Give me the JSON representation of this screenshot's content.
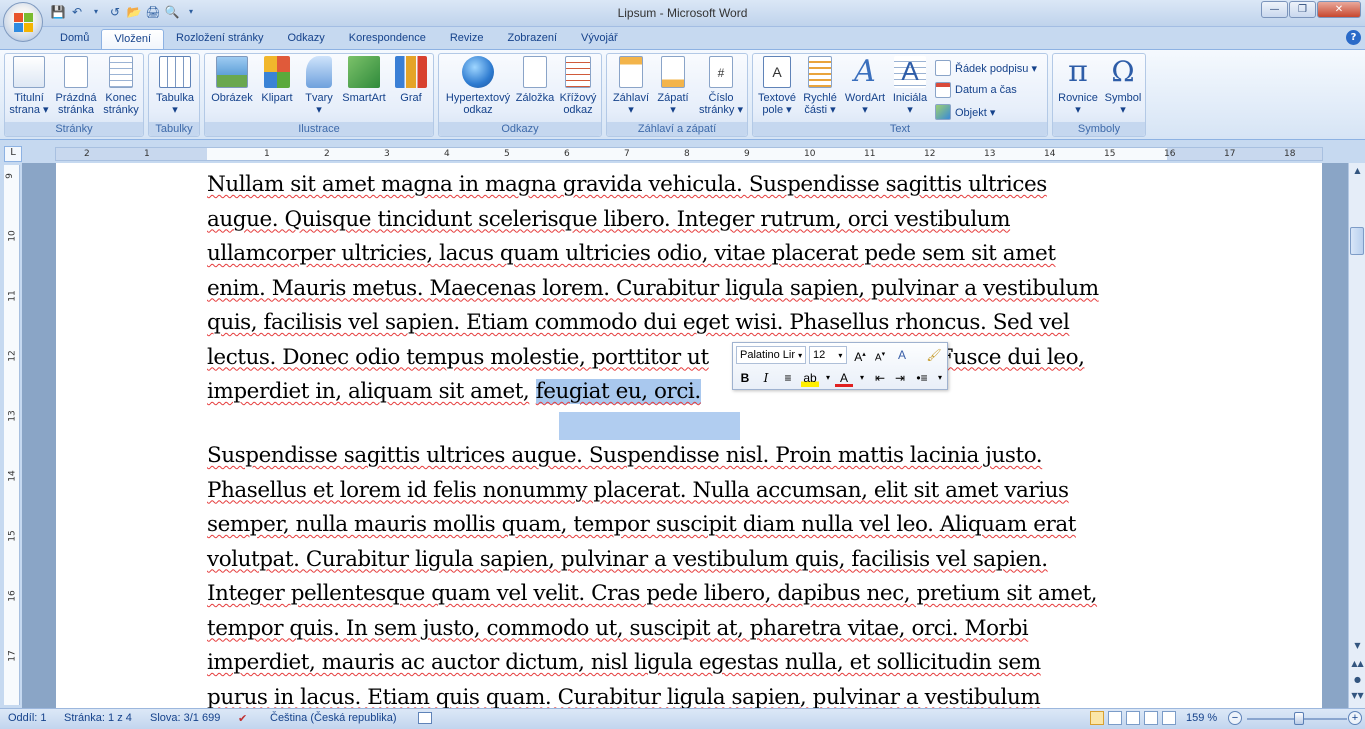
{
  "window": {
    "title": "Lipsum - Microsoft Word"
  },
  "quick_access": [
    "save-icon",
    "undo-icon",
    "redo-icon",
    "open-icon",
    "print-icon",
    "print-preview-icon"
  ],
  "tabs": [
    "Domů",
    "Vložení",
    "Rozložení stránky",
    "Odkazy",
    "Korespondence",
    "Revize",
    "Zobrazení",
    "Vývojář"
  ],
  "active_tab": "Vložení",
  "ribbon": {
    "groups": {
      "pages": {
        "title": "Stránky",
        "buttons": [
          [
            "Titulní",
            "strana ▾"
          ],
          [
            "Prázdná",
            "stránka"
          ],
          [
            "Konec",
            "stránky"
          ]
        ]
      },
      "tables": {
        "title": "Tabulky",
        "buttons": [
          [
            "Tabulka",
            "▾"
          ]
        ]
      },
      "illustrations": {
        "title": "Ilustrace",
        "buttons": [
          [
            "Obrázek",
            ""
          ],
          [
            "Klipart",
            ""
          ],
          [
            "Tvary",
            "▾"
          ],
          [
            "SmartArt",
            ""
          ],
          [
            "Graf",
            ""
          ]
        ]
      },
      "links": {
        "title": "Odkazy",
        "buttons": [
          [
            "Hypertextový",
            "odkaz"
          ],
          [
            "Záložka",
            ""
          ],
          [
            "Křížový",
            "odkaz"
          ]
        ]
      },
      "header_footer": {
        "title": "Záhlaví a zápatí",
        "buttons": [
          [
            "Záhlaví",
            "▾"
          ],
          [
            "Zápatí",
            "▾"
          ],
          [
            "Číslo",
            "stránky ▾"
          ]
        ]
      },
      "text": {
        "title": "Text",
        "buttons": [
          [
            "Textové",
            "pole ▾"
          ],
          [
            "Rychlé",
            "části ▾"
          ],
          [
            "WordArt",
            "▾"
          ],
          [
            "Iniciála",
            "▾"
          ]
        ],
        "small": [
          "Řádek podpisu ▾",
          "Datum a čas",
          "Objekt ▾"
        ]
      },
      "symbols": {
        "title": "Symboly",
        "buttons": [
          [
            "Rovnice",
            "▾"
          ],
          [
            "Symbol",
            "▾"
          ]
        ]
      }
    }
  },
  "ruler": {
    "h_numbers": [
      "2",
      "1",
      "1",
      "2",
      "3",
      "4",
      "5",
      "6",
      "7",
      "8",
      "9",
      "10",
      "11",
      "12",
      "13",
      "14",
      "15",
      "16",
      "17",
      "18"
    ],
    "v_numbers": [
      "9",
      "10",
      "11",
      "12",
      "13",
      "14",
      "15",
      "16",
      "17"
    ]
  },
  "document": {
    "para1": [
      "Nullam sit amet magna in magna gravida vehicula. Suspendisse sagittis ultrices",
      "augue. Quisque tincidunt scelerisque libero. Integer rutrum, orci vestibulum",
      "ullamcorper ultricies, lacus quam ultricies odio, vitae placerat pede sem sit amet",
      "enim. Mauris metus. Maecenas lorem. Curabitur ligula sapien, pulvinar a vestibulum",
      "quis, facilisis vel sapien. Etiam commodo dui eget wisi. Phasellus rhoncus. Sed vel",
      "lectus. Donec odio tempus molestie, porttitor ut",
      "Fusce dui leo,",
      "imperdiet in, aliquam sit amet,",
      "feugiat eu, orci."
    ],
    "para2": [
      "Suspendisse sagittis ultrices augue. Suspendisse nisl. Proin mattis lacinia justo.",
      "Phasellus et lorem id felis nonummy placerat. Nulla accumsan, elit sit amet varius",
      "semper, nulla mauris mollis quam, tempor suscipit diam nulla vel leo. Aliquam erat",
      "volutpat. Curabitur ligula sapien, pulvinar a vestibulum quis, facilisis vel sapien.",
      "Integer pellentesque quam vel velit. Cras pede libero, dapibus nec, pretium sit amet,",
      "tempor quis. In sem justo, commodo ut, suscipit at, pharetra vitae, orci. Morbi",
      "imperdiet, mauris ac auctor dictum, nisl ligula egestas nulla, et sollicitudin sem",
      "purus in lacus. Etiam quis quam. Curabitur ligula sapien, pulvinar a vestibulum"
    ]
  },
  "mini_toolbar": {
    "font": "Palatino Lir",
    "size": "12"
  },
  "status": {
    "section": "Oddíl: 1",
    "page": "Stránka: 1 z 4",
    "words": "Slova: 3/1 699",
    "language": "Čeština (Česká republika)",
    "zoom": "159 %"
  },
  "colors": {
    "accent": "#15428b",
    "selection": "#a9c8ee",
    "spell": "#e53b3b"
  }
}
